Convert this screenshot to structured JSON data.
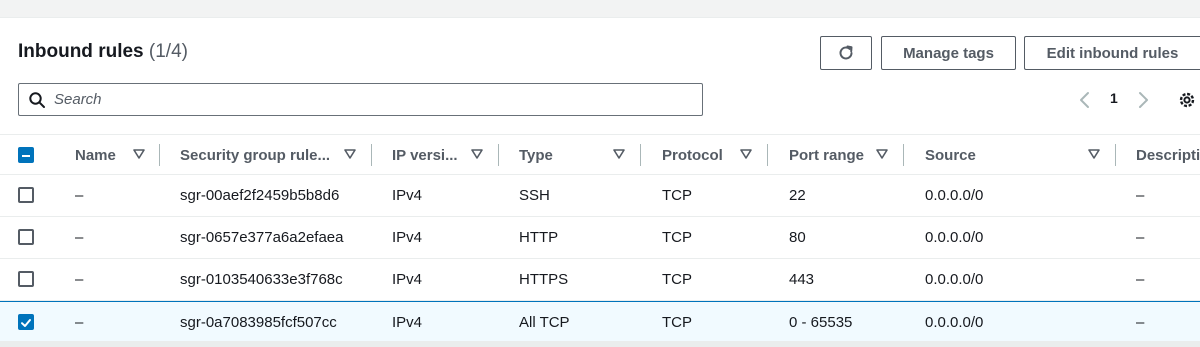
{
  "header": {
    "title": "Inbound rules",
    "count": "(1/4)"
  },
  "toolbar": {
    "refresh_icon": "refresh-icon",
    "manage_tags_label": "Manage tags",
    "edit_rules_label": "Edit inbound rules"
  },
  "search": {
    "placeholder": "Search",
    "value": ""
  },
  "pagination": {
    "current_page": "1"
  },
  "table": {
    "columns": [
      "Name",
      "Security group rule...",
      "IP versi...",
      "Type",
      "Protocol",
      "Port range",
      "Source",
      "Descripti"
    ],
    "rows": [
      {
        "selected": false,
        "name": "–",
        "rule_id": "sgr-00aef2f2459b5b8d6",
        "ip_version": "IPv4",
        "type": "SSH",
        "protocol": "TCP",
        "port_range": "22",
        "source": "0.0.0.0/0",
        "description": "–"
      },
      {
        "selected": false,
        "name": "–",
        "rule_id": "sgr-0657e377a6a2efaea",
        "ip_version": "IPv4",
        "type": "HTTP",
        "protocol": "TCP",
        "port_range": "80",
        "source": "0.0.0.0/0",
        "description": "–"
      },
      {
        "selected": false,
        "name": "–",
        "rule_id": "sgr-0103540633e3f768c",
        "ip_version": "IPv4",
        "type": "HTTPS",
        "protocol": "TCP",
        "port_range": "443",
        "source": "0.0.0.0/0",
        "description": "–"
      },
      {
        "selected": true,
        "name": "–",
        "rule_id": "sgr-0a7083985fcf507cc",
        "ip_version": "IPv4",
        "type": "All TCP",
        "protocol": "TCP",
        "port_range": "0 - 65535",
        "source": "0.0.0.0/0",
        "description": "–"
      }
    ]
  },
  "colors": {
    "accent": "#0073bb",
    "selected_row_bg": "#f1faff"
  }
}
